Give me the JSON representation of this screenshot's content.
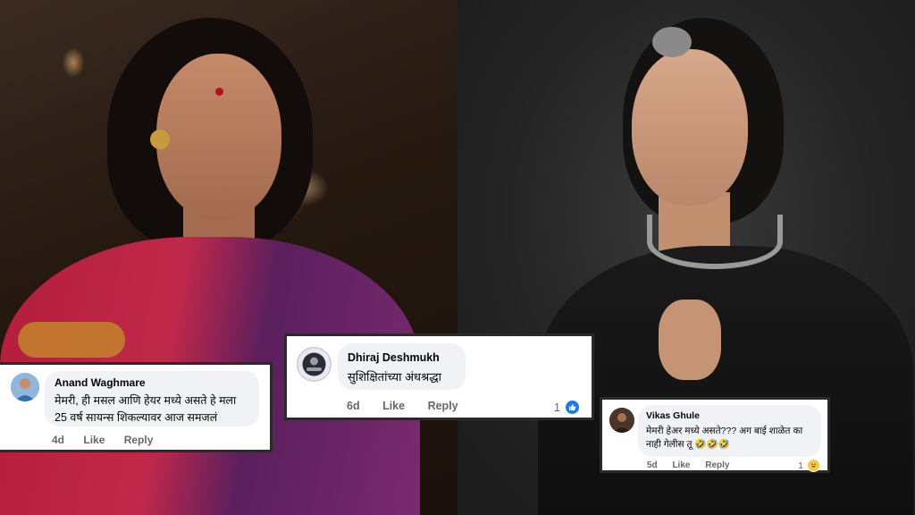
{
  "photos": {
    "left_alt": "woman in red and purple saree",
    "right_alt": "woman in black outfit with silver jewellery"
  },
  "comments": [
    {
      "name": "Anand Waghmare",
      "text_line1": "मेमरी, ही मसल आणि हेयर मध्ये असते हे मला",
      "text_line2": "25 वर्ष सायन्स शिकल्यावर आज समजलं",
      "time": "4d",
      "like_label": "Like",
      "reply_label": "Reply"
    },
    {
      "name": "Dhiraj Deshmukh",
      "text": "सुशिक्षितांच्या अंधश्रद्धा",
      "time": "6d",
      "like_label": "Like",
      "reply_label": "Reply",
      "reaction_count": "1"
    },
    {
      "name": "Vikas Ghule",
      "text_line1": "मेमरी हेअर मध्ये असते??? अग बाई शाळेत का",
      "text_line2": "नाही गेलीस तू 🤣🤣🤣",
      "time": "5d",
      "like_label": "Like",
      "reply_label": "Reply",
      "reaction_count": "1"
    }
  ],
  "colors": {
    "bubble": "#f0f2f5",
    "meta": "#65676b",
    "like_blue": "#1877f2"
  },
  "icons": {
    "like_reaction": "thumbs-up-icon",
    "haha_reaction": "laughing-emoji-icon"
  }
}
